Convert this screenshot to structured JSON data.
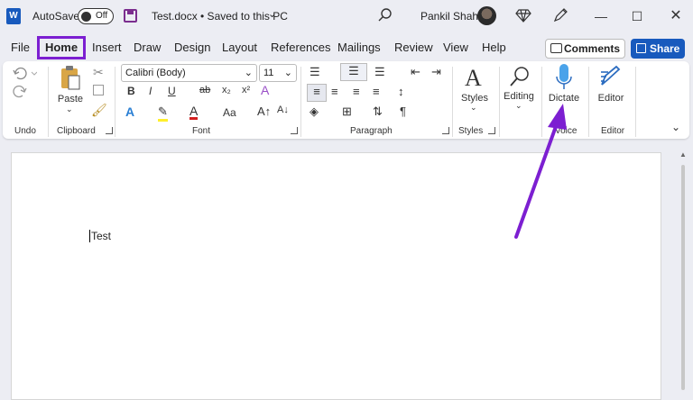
{
  "titlebar": {
    "logo": "W",
    "autosave_label": "AutoSave",
    "autosave_state": "Off",
    "doc_title": "Test.docx • Saved to this PC",
    "user_name": "Pankil Shah",
    "window_controls": [
      "minimize-icon",
      "maximize-icon",
      "close-icon"
    ]
  },
  "menu": {
    "tabs": [
      "File",
      "Home",
      "Insert",
      "Draw",
      "Design",
      "Layout",
      "References",
      "Mailings",
      "Review",
      "View",
      "Help"
    ],
    "active_tab": "Home",
    "comments_label": "Comments",
    "share_label": "Share"
  },
  "ribbon": {
    "groups": {
      "undo": "Undo",
      "clipboard": "Clipboard",
      "font": "Font",
      "paragraph": "Paragraph",
      "styles": "Styles",
      "voice": "Voice",
      "editor": "Editor"
    },
    "paste_label": "Paste",
    "font_name": "Calibri (Body)",
    "font_size": "11",
    "styles_label": "Styles",
    "editing_label": "Editing",
    "dictate_label": "Dictate",
    "editor_label": "Editor",
    "font_buttons": [
      "B",
      "I",
      "U",
      "ab",
      "x₂",
      "x²",
      "A",
      "A",
      "Aa",
      "A↑",
      "A↓"
    ],
    "paragraph_mark": "¶"
  },
  "document": {
    "text": "Test"
  },
  "colors": {
    "highlight_box": "#7c1fd1",
    "arrow": "#7c1fd1",
    "share_button": "#185abd"
  }
}
